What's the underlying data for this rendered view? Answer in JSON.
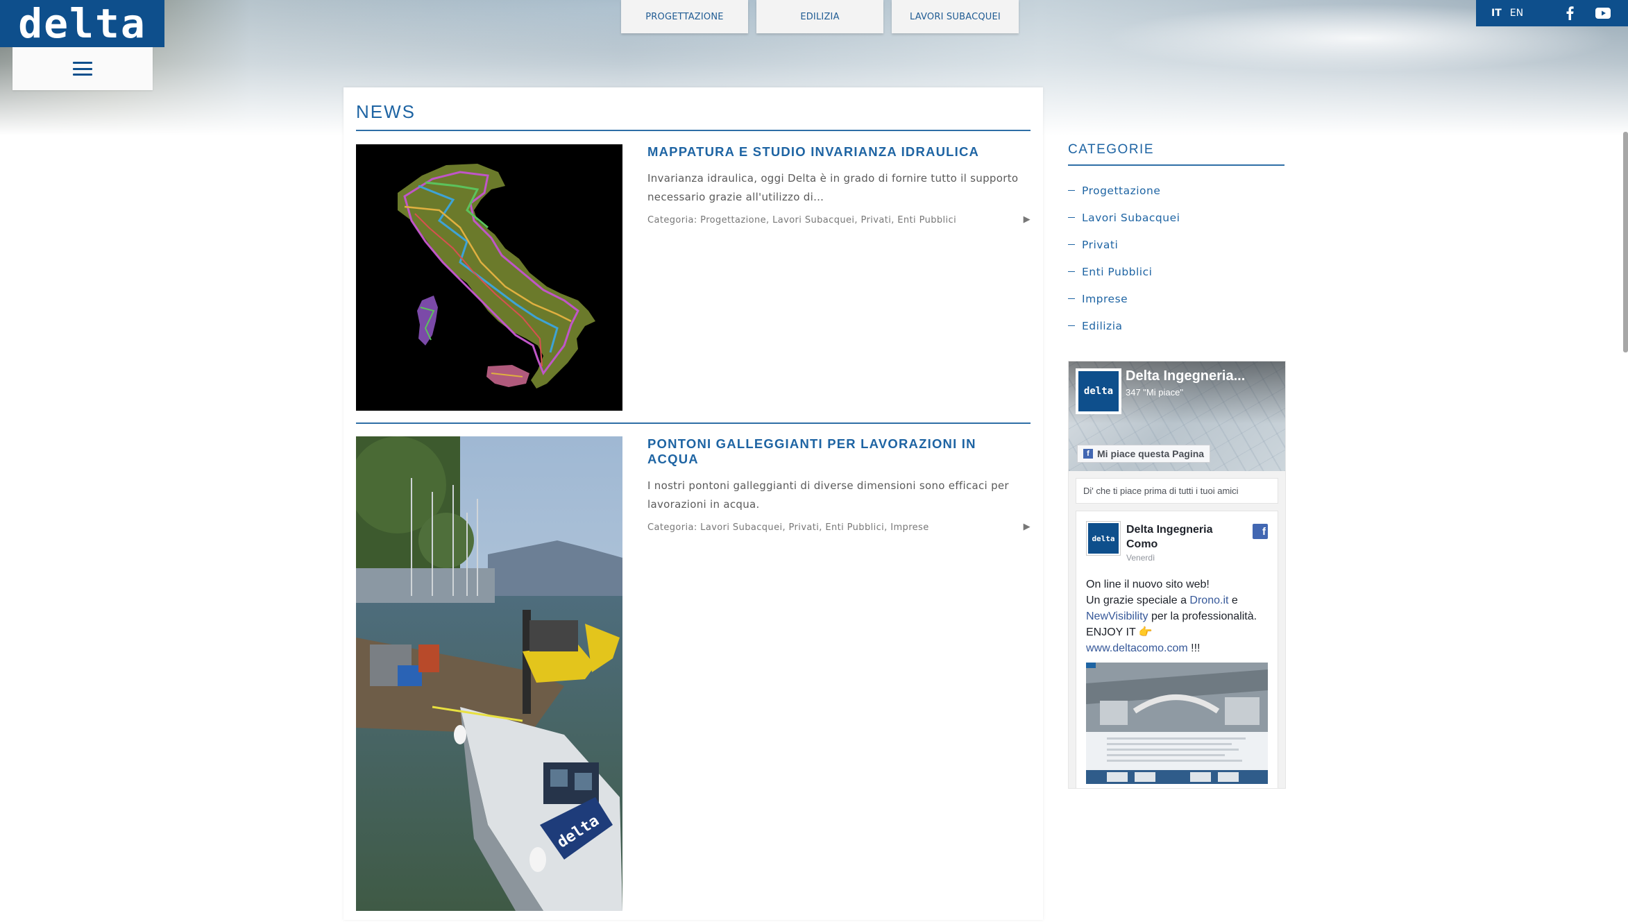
{
  "brand": {
    "logo_text": "delta",
    "color": "#0e4f8c"
  },
  "topnav": {
    "tabs": [
      "PROGETTAZIONE",
      "EDILIZIA",
      "LAVORI SUBACQUEI"
    ]
  },
  "topbar": {
    "lang_it": "IT",
    "lang_en": "EN",
    "icons": [
      "facebook-icon",
      "youtube-icon"
    ]
  },
  "main": {
    "title": "NEWS",
    "articles": [
      {
        "title": "MAPPATURA E STUDIO INVARIANZA IDRAULICA",
        "excerpt": "Invarianza idraulica, oggi Delta è in grado di fornire tutto il supporto necessario grazie all'utilizzo di…",
        "categories": "Categoria: Progettazione, Lavori Subacquei, Privati, Enti Pubblici",
        "more": "▶"
      },
      {
        "title": "PONTONI GALLEGGIANTI PER LAVORAZIONI IN ACQUA",
        "excerpt": "I nostri pontoni galleggianti di diverse dimensioni sono efficaci per lavorazioni in acqua.",
        "categories": "Categoria: Lavori Subacquei, Privati, Enti Pubblici, Imprese",
        "more": "▶",
        "boat_lettering": "delta"
      }
    ]
  },
  "sidebar": {
    "title": "CATEGORIE",
    "categories": [
      "Progettazione",
      "Lavori Subacquei",
      "Privati",
      "Enti Pubblici",
      "Imprese",
      "Edilizia"
    ],
    "facebook": {
      "page_name": "Delta Ingegneria...",
      "likes": "347 \"Mi piace\"",
      "like_button": "Mi piace questa Pagina",
      "friends_text": "Di' che ti piace prima di tutti i tuoi amici",
      "post": {
        "author": "Delta Ingegneria Como",
        "date": "Venerdì",
        "line1": "On line il nuovo sito web!",
        "line2_a": "Un grazie speciale a ",
        "link1": "Drono.it",
        "line2_b": " e",
        "link2": "NewVisibility",
        "line3": " per la professionalità. ENJOY IT 👉",
        "link3": "www.deltacomo.com",
        "line4": " !!!"
      },
      "avatar_text": "delta"
    }
  }
}
